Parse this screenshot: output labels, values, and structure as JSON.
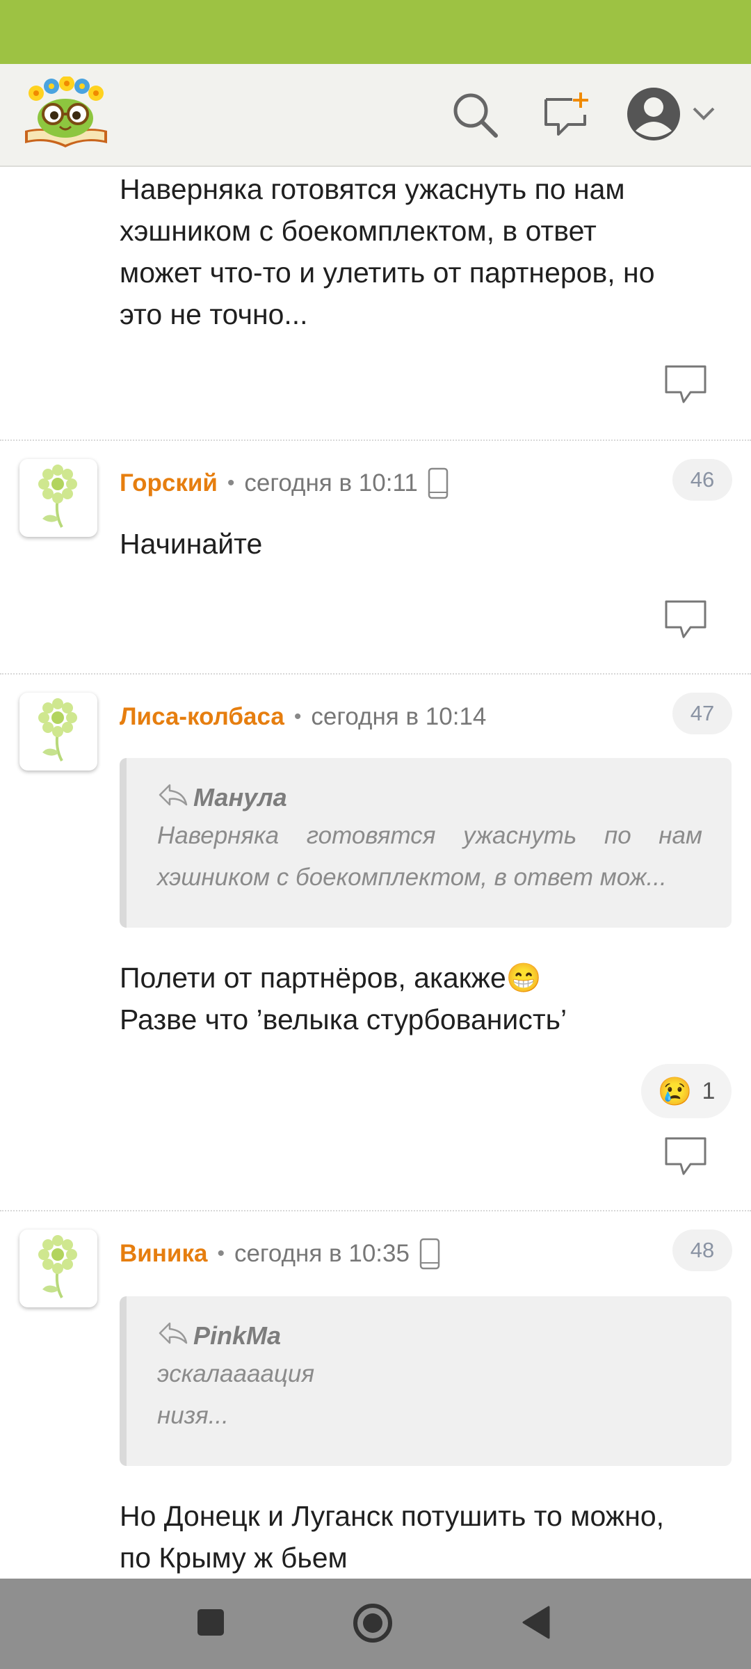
{
  "header": {
    "icons": [
      "logo-owl-book",
      "search-icon",
      "new-post-icon",
      "avatar-icon",
      "chevron-down-icon"
    ]
  },
  "top_comment": {
    "text_lines": [
      "Наверняка готовятся ужаснуть по нам",
      "хэшником с боекомплектом, в ответ",
      "может что-то и улетить от партнеров, но",
      "это не точно..."
    ]
  },
  "comments": [
    {
      "author": "Горский",
      "time": "сегодня в 10:11",
      "number": "46",
      "mobile": true,
      "text_lines": [
        "Начинайте"
      ]
    },
    {
      "author": "Лиса-колбаса",
      "time": "сегодня в 10:14",
      "number": "47",
      "mobile": false,
      "quote": {
        "author": "Манула",
        "lines": [
          "Наверняка готовятся ужаснуть по нам",
          "хэшником с боекомплектом, в ответ мож..."
        ]
      },
      "text_lines": [
        "Полети от партнёров, акакже😁",
        "Разве что ’велыка стурбованисть’"
      ],
      "reaction": {
        "emoji": "😢",
        "count": "1"
      }
    },
    {
      "author": "Виника",
      "time": "сегодня в 10:35",
      "number": "48",
      "mobile": true,
      "quote": {
        "author": "PinkMa",
        "lines": [
          "эскалаааация",
          "низя..."
        ]
      },
      "text_lines": [
        "Но Донецк и Луганск потушить то можно,",
        "по Крыму ж бьем"
      ]
    }
  ],
  "colors": {
    "status_bar": "#9dc243",
    "author": "#e67e0f",
    "nav_bar": "#8f8f8f"
  }
}
